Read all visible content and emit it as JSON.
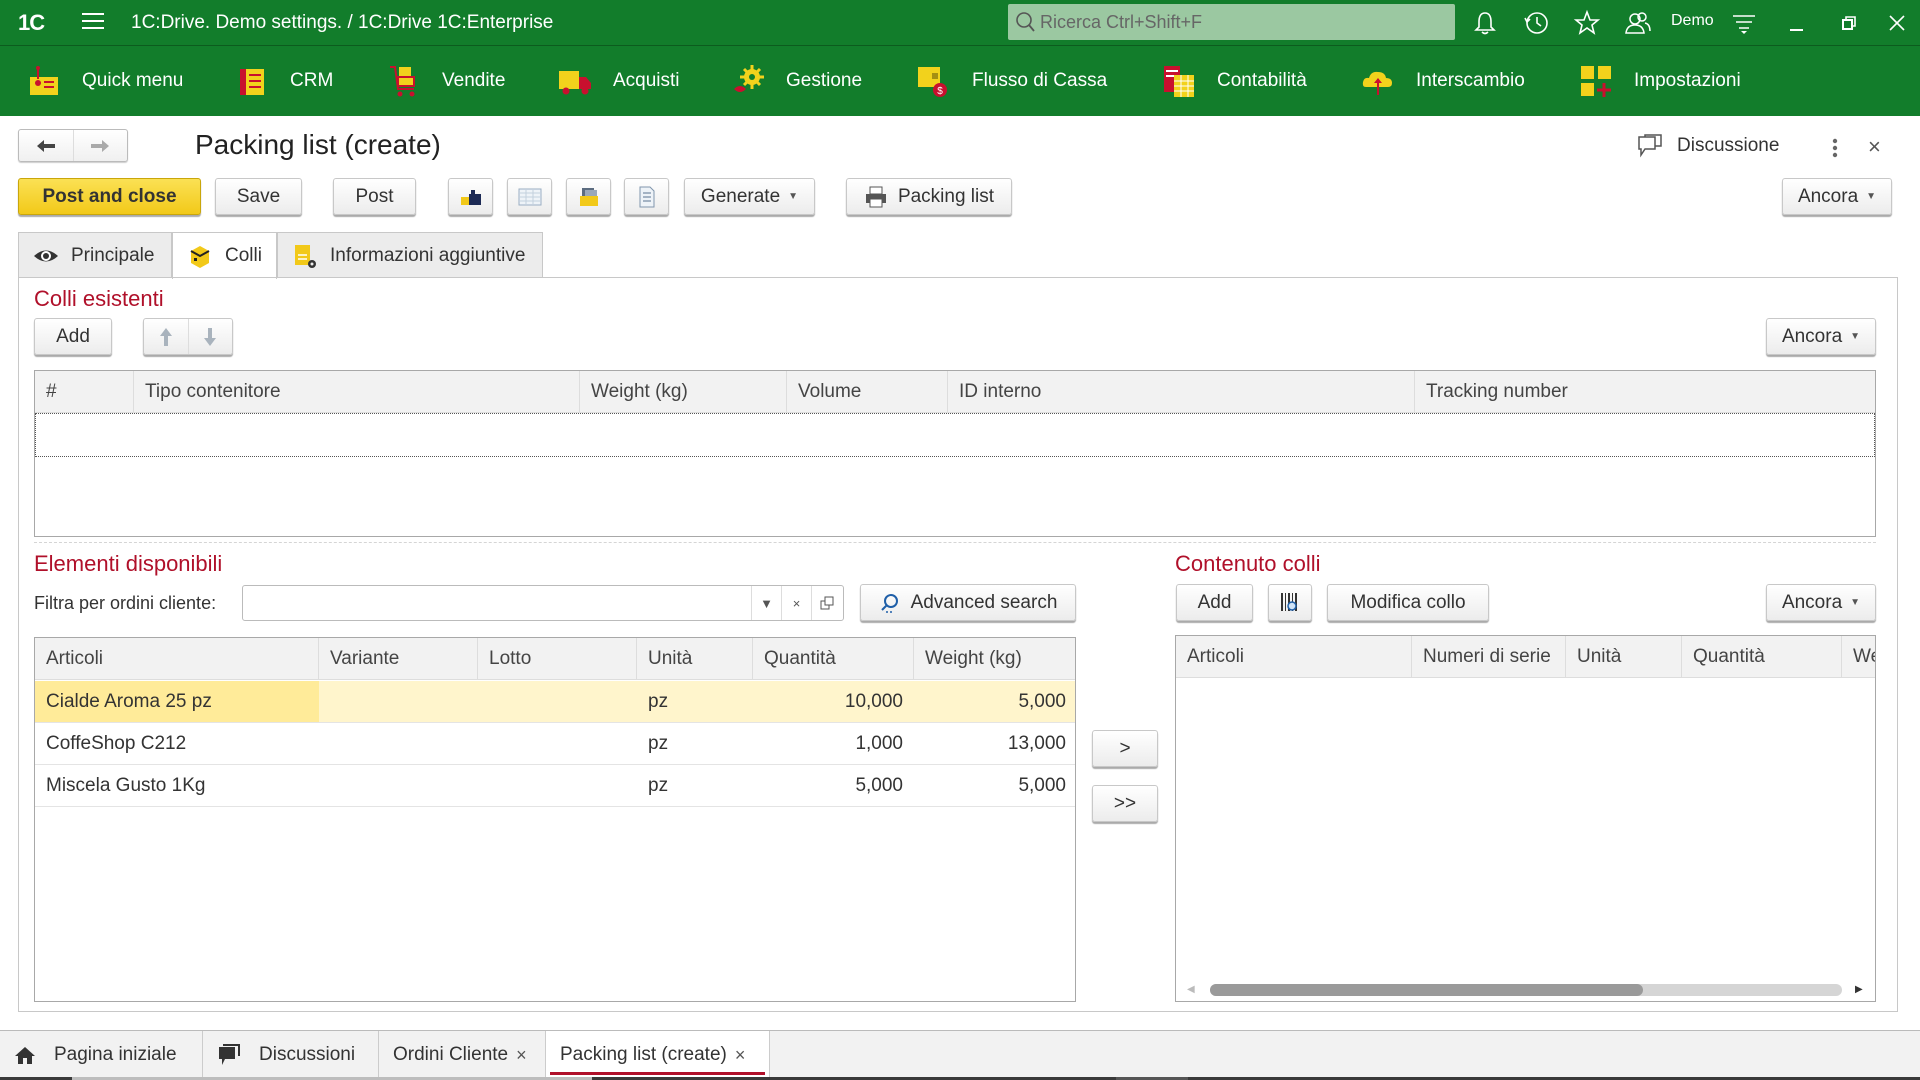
{
  "app": {
    "logo": "1C",
    "title": "1C:Drive. Demo settings. / 1C:Drive 1C:Enterprise",
    "search_placeholder": "Ricerca Ctrl+Shift+F",
    "user": "Demo",
    "icons": [
      "bell-icon",
      "history-icon",
      "star-icon",
      "users-icon",
      "settings-menu-icon",
      "minimize-icon",
      "restore-icon",
      "close-icon"
    ]
  },
  "sections": [
    {
      "label": "Quick menu",
      "icon": "quick-menu-icon"
    },
    {
      "label": "CRM",
      "icon": "crm-icon"
    },
    {
      "label": "Vendite",
      "icon": "cart-icon"
    },
    {
      "label": "Acquisti",
      "icon": "truck-icon"
    },
    {
      "label": "Gestione",
      "icon": "gear-icon"
    },
    {
      "label": "Flusso di Cassa",
      "icon": "wallet-icon"
    },
    {
      "label": "Contabilità",
      "icon": "ledger-icon"
    },
    {
      "label": "Interscambio",
      "icon": "cloud-exchange-icon"
    },
    {
      "label": "Impostazioni",
      "icon": "settings-grid-icon"
    }
  ],
  "form": {
    "title": "Packing list (create)",
    "discussion_label": "Discussione",
    "toolbar": {
      "post_and_close": "Post and close",
      "save": "Save",
      "post": "Post",
      "generate": "Generate",
      "packing_list": "Packing list",
      "more": "Ancora"
    },
    "tabs": [
      {
        "label": "Principale",
        "active": false
      },
      {
        "label": "Colli",
        "active": true
      },
      {
        "label": "Informazioni aggiuntive",
        "active": false
      }
    ]
  },
  "colli_esistenti": {
    "heading": "Colli esistenti",
    "add": "Add",
    "more": "Ancora",
    "columns": [
      "#",
      "Tipo contenitore",
      "Weight (kg)",
      "Volume",
      "ID interno",
      "Tracking number"
    ],
    "rows": []
  },
  "elementi_disponibili": {
    "heading": "Elementi disponibili",
    "filter_label": "Filtra per ordini cliente:",
    "filter_value": "",
    "advanced_search": "Advanced search",
    "columns": [
      "Articoli",
      "Variante",
      "Lotto",
      "Unità",
      "Quantità",
      "Weight (kg)"
    ],
    "rows": [
      {
        "articolo": "Cialde Aroma 25 pz",
        "variante": "",
        "lotto": "",
        "unita": "pz",
        "quantita": "10,000",
        "weight": "5,000",
        "selected": true
      },
      {
        "articolo": "CoffeShop C212",
        "variante": "",
        "lotto": "",
        "unita": "pz",
        "quantita": "1,000",
        "weight": "13,000",
        "selected": false
      },
      {
        "articolo": "Miscela Gusto 1Kg",
        "variante": "",
        "lotto": "",
        "unita": "pz",
        "quantita": "5,000",
        "weight": "5,000",
        "selected": false
      }
    ]
  },
  "transfer": {
    "one": ">",
    "all": ">>"
  },
  "contenuto_colli": {
    "heading": "Contenuto colli",
    "add": "Add",
    "edit_package": "Modifica collo",
    "more": "Ancora",
    "columns": [
      "Articoli",
      "Numeri di serie",
      "Unità",
      "Quantità",
      "We"
    ],
    "rows": []
  },
  "bottom_tabs": [
    {
      "label": "Pagina iniziale",
      "icon": "home-icon",
      "closable": false,
      "active": false
    },
    {
      "label": "Discussioni",
      "icon": "chat-icon",
      "closable": false,
      "active": false
    },
    {
      "label": "Ordini Cliente",
      "closable": true,
      "active": false
    },
    {
      "label": "Packing list (create)",
      "closable": true,
      "active": true
    }
  ],
  "colors": {
    "brand_green": "#127d2b",
    "primary_button": "#f5d02a",
    "heading_red": "#b0102a",
    "selected_row": "#fff5cc"
  }
}
